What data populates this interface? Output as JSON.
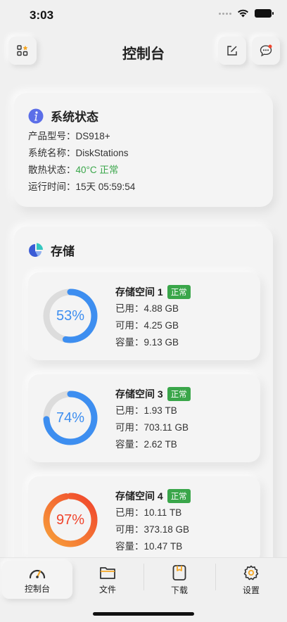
{
  "status_bar": {
    "time": "3:03"
  },
  "header": {
    "title": "控制台"
  },
  "system": {
    "title": "系统状态",
    "rows": [
      {
        "label": "产品型号：",
        "value": "DS918+"
      },
      {
        "label": "系统名称：",
        "value": "DiskStations"
      },
      {
        "label": "散热状态：",
        "value": "40°C 正常"
      },
      {
        "label": "运行时间：",
        "value": "15天 05:59:54"
      }
    ]
  },
  "storage": {
    "title": "存储",
    "items": [
      {
        "name": "存储空间 1",
        "status": "正常",
        "used": "已用：4.88 GB",
        "free": "可用：4.25 GB",
        "capacity": "容量：9.13 GB",
        "percent": "53%",
        "fraction": 0.53,
        "color": "#3d8ef0"
      },
      {
        "name": "存储空间 3",
        "status": "正常",
        "used": "已用：1.93 TB",
        "free": "可用：703.11 GB",
        "capacity": "容量：2.62 TB",
        "percent": "74%",
        "fraction": 0.74,
        "color": "#3d8ef0"
      },
      {
        "name": "存储空间 4",
        "status": "正常",
        "used": "已用：10.11 TB",
        "free": "可用：373.18 GB",
        "capacity": "容量：10.47 TB",
        "percent": "97%",
        "fraction": 0.97,
        "color": "#f0442c"
      }
    ]
  },
  "tabs": [
    {
      "label": "控制台",
      "icon": "dashboard-icon",
      "active": true
    },
    {
      "label": "文件",
      "icon": "folder-icon",
      "active": false
    },
    {
      "label": "下载",
      "icon": "download-icon",
      "active": false
    },
    {
      "label": "设置",
      "icon": "gear-icon",
      "active": false
    }
  ],
  "colors": {
    "ok_green": "#3aa64a",
    "blue": "#3d8ef0",
    "red": "#f0442c",
    "orange": "#f7a03a"
  }
}
